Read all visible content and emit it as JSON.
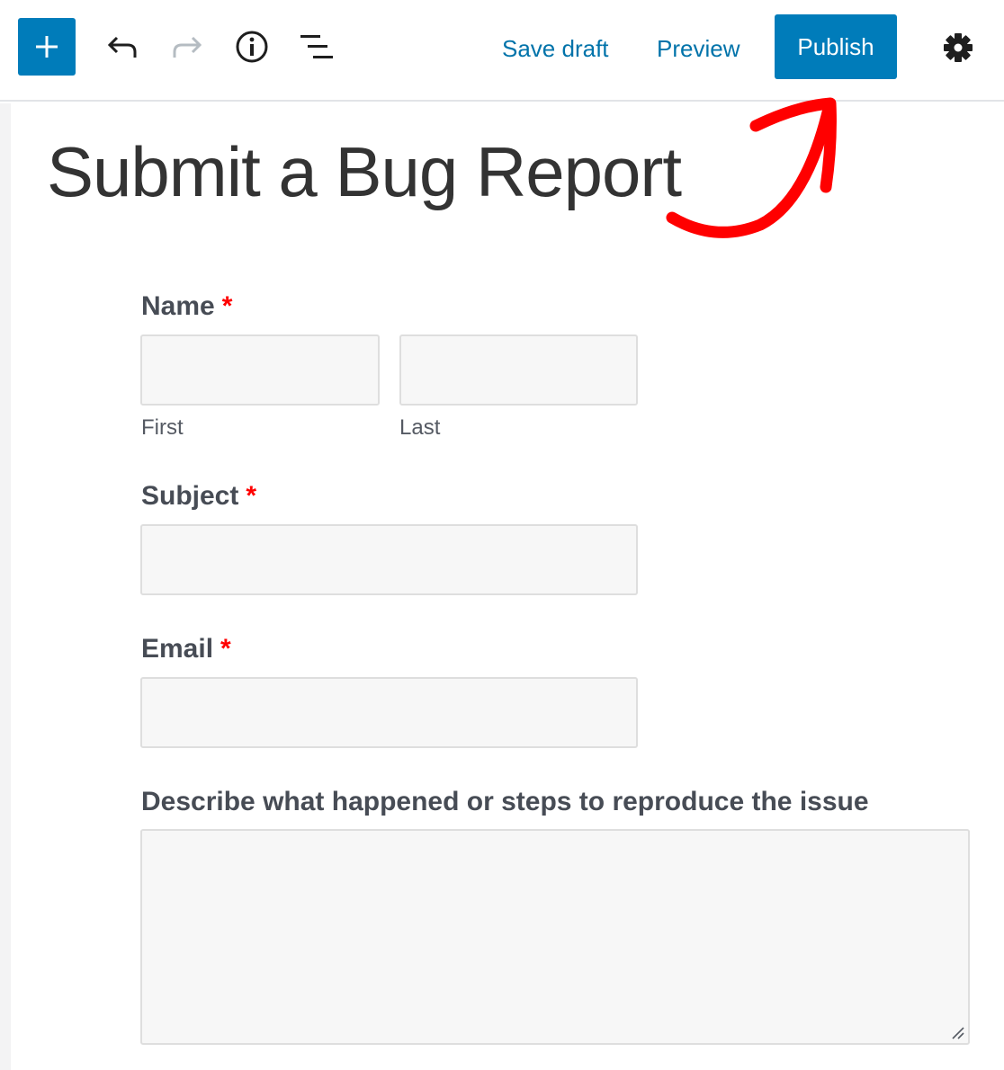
{
  "toolbar": {
    "add_icon": "plus-icon",
    "undo_icon": "undo-icon",
    "redo_icon": "redo-icon",
    "info_icon": "info-icon",
    "outline_icon": "block-navigation-icon",
    "save_draft_label": "Save draft",
    "preview_label": "Preview",
    "publish_label": "Publish",
    "settings_icon": "gear-icon",
    "accent_color": "#007cba"
  },
  "page": {
    "title": "Submit a Bug Report"
  },
  "annotation": {
    "arrow_color": "#ff0000",
    "points_to": "Publish"
  },
  "form": {
    "required_marker": "*",
    "name": {
      "label": "Name",
      "first_label": "First",
      "last_label": "Last",
      "first_value": "",
      "last_value": ""
    },
    "subject": {
      "label": "Subject",
      "value": ""
    },
    "email": {
      "label": "Email",
      "value": ""
    },
    "description": {
      "label": "Describe what happened or steps to reproduce the issue",
      "value": ""
    }
  }
}
